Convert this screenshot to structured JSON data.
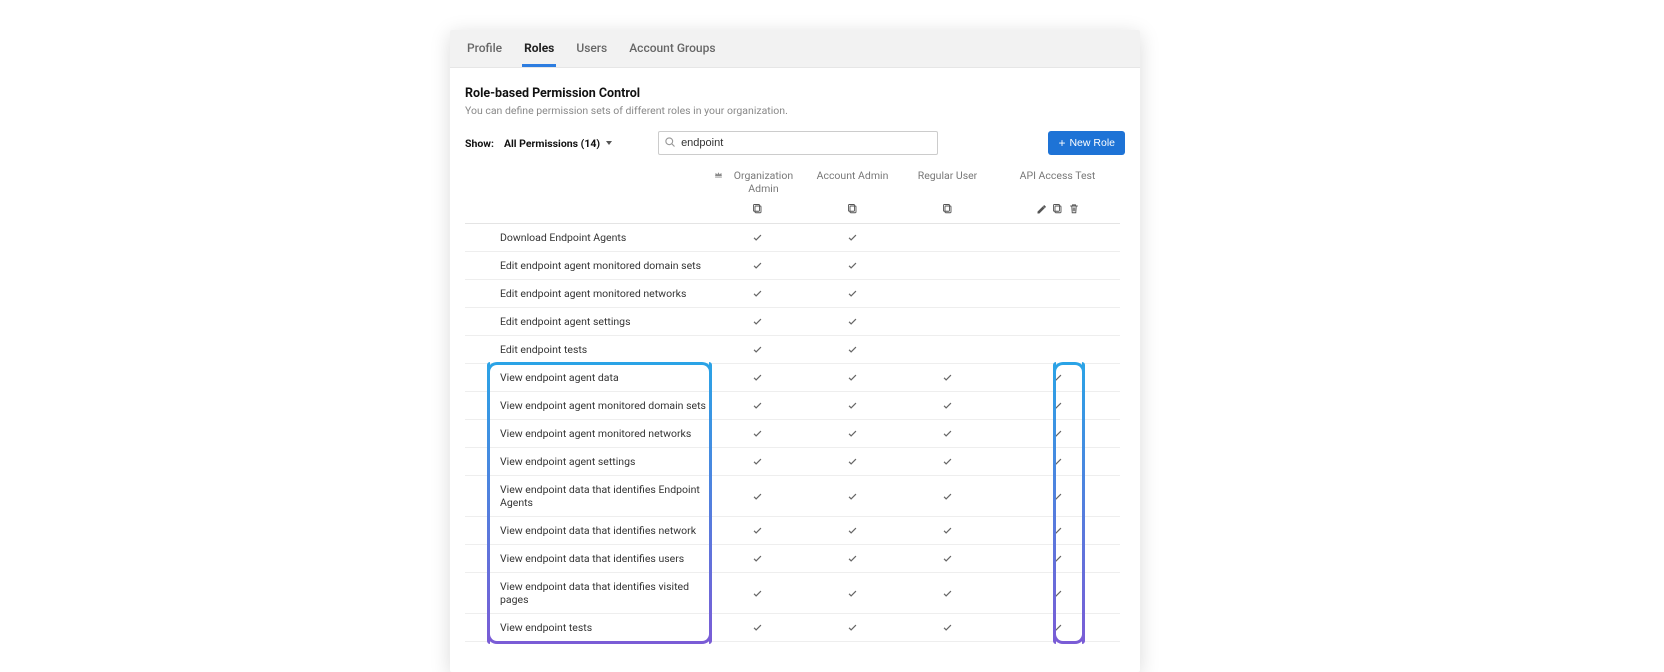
{
  "tabs": [
    "Profile",
    "Roles",
    "Users",
    "Account Groups"
  ],
  "activeTab": 1,
  "page": {
    "title": "Role-based Permission Control",
    "subtitle": "You can define permission sets of different roles in your organization."
  },
  "filter": {
    "showLabel": "Show:",
    "showValue": "All Permissions (14)"
  },
  "search": {
    "value": "endpoint",
    "placeholder": "Search"
  },
  "newRoleLabel": "New Role",
  "columns": [
    {
      "label": "Organization Admin",
      "crown": true,
      "actions": [
        "copy"
      ]
    },
    {
      "label": "Account Admin",
      "crown": false,
      "actions": [
        "copy"
      ]
    },
    {
      "label": "Regular User",
      "crown": false,
      "actions": [
        "copy"
      ]
    },
    {
      "label": "API Access Test",
      "crown": false,
      "actions": [
        "edit",
        "copy",
        "delete"
      ]
    }
  ],
  "permissions": [
    {
      "name": "Download Endpoint Agents",
      "checks": [
        true,
        true,
        false,
        false
      ],
      "highlight": false
    },
    {
      "name": "Edit endpoint agent monitored domain sets",
      "checks": [
        true,
        true,
        false,
        false
      ],
      "highlight": false
    },
    {
      "name": "Edit endpoint agent monitored networks",
      "checks": [
        true,
        true,
        false,
        false
      ],
      "highlight": false
    },
    {
      "name": "Edit endpoint agent settings",
      "checks": [
        true,
        true,
        false,
        false
      ],
      "highlight": false
    },
    {
      "name": "Edit endpoint tests",
      "checks": [
        true,
        true,
        false,
        false
      ],
      "highlight": false
    },
    {
      "name": "View endpoint agent data",
      "checks": [
        true,
        true,
        true,
        true
      ],
      "highlight": true
    },
    {
      "name": "View endpoint agent monitored domain sets",
      "checks": [
        true,
        true,
        true,
        true
      ],
      "highlight": true
    },
    {
      "name": "View endpoint agent monitored networks",
      "checks": [
        true,
        true,
        true,
        true
      ],
      "highlight": true
    },
    {
      "name": "View endpoint agent settings",
      "checks": [
        true,
        true,
        true,
        true
      ],
      "highlight": true
    },
    {
      "name": "View endpoint data that identifies Endpoint Agents",
      "checks": [
        true,
        true,
        true,
        true
      ],
      "highlight": true
    },
    {
      "name": "View endpoint data that identifies network",
      "checks": [
        true,
        true,
        true,
        true
      ],
      "highlight": true
    },
    {
      "name": "View endpoint data that identifies users",
      "checks": [
        true,
        true,
        true,
        true
      ],
      "highlight": true
    },
    {
      "name": "View endpoint data that identifies visited pages",
      "checks": [
        true,
        true,
        true,
        true
      ],
      "highlight": true
    },
    {
      "name": "View endpoint tests",
      "checks": [
        true,
        true,
        true,
        true
      ],
      "highlight": true
    }
  ],
  "highlightColors": {
    "top": "#2aa3e6",
    "bottom": "#7a5cd6"
  }
}
